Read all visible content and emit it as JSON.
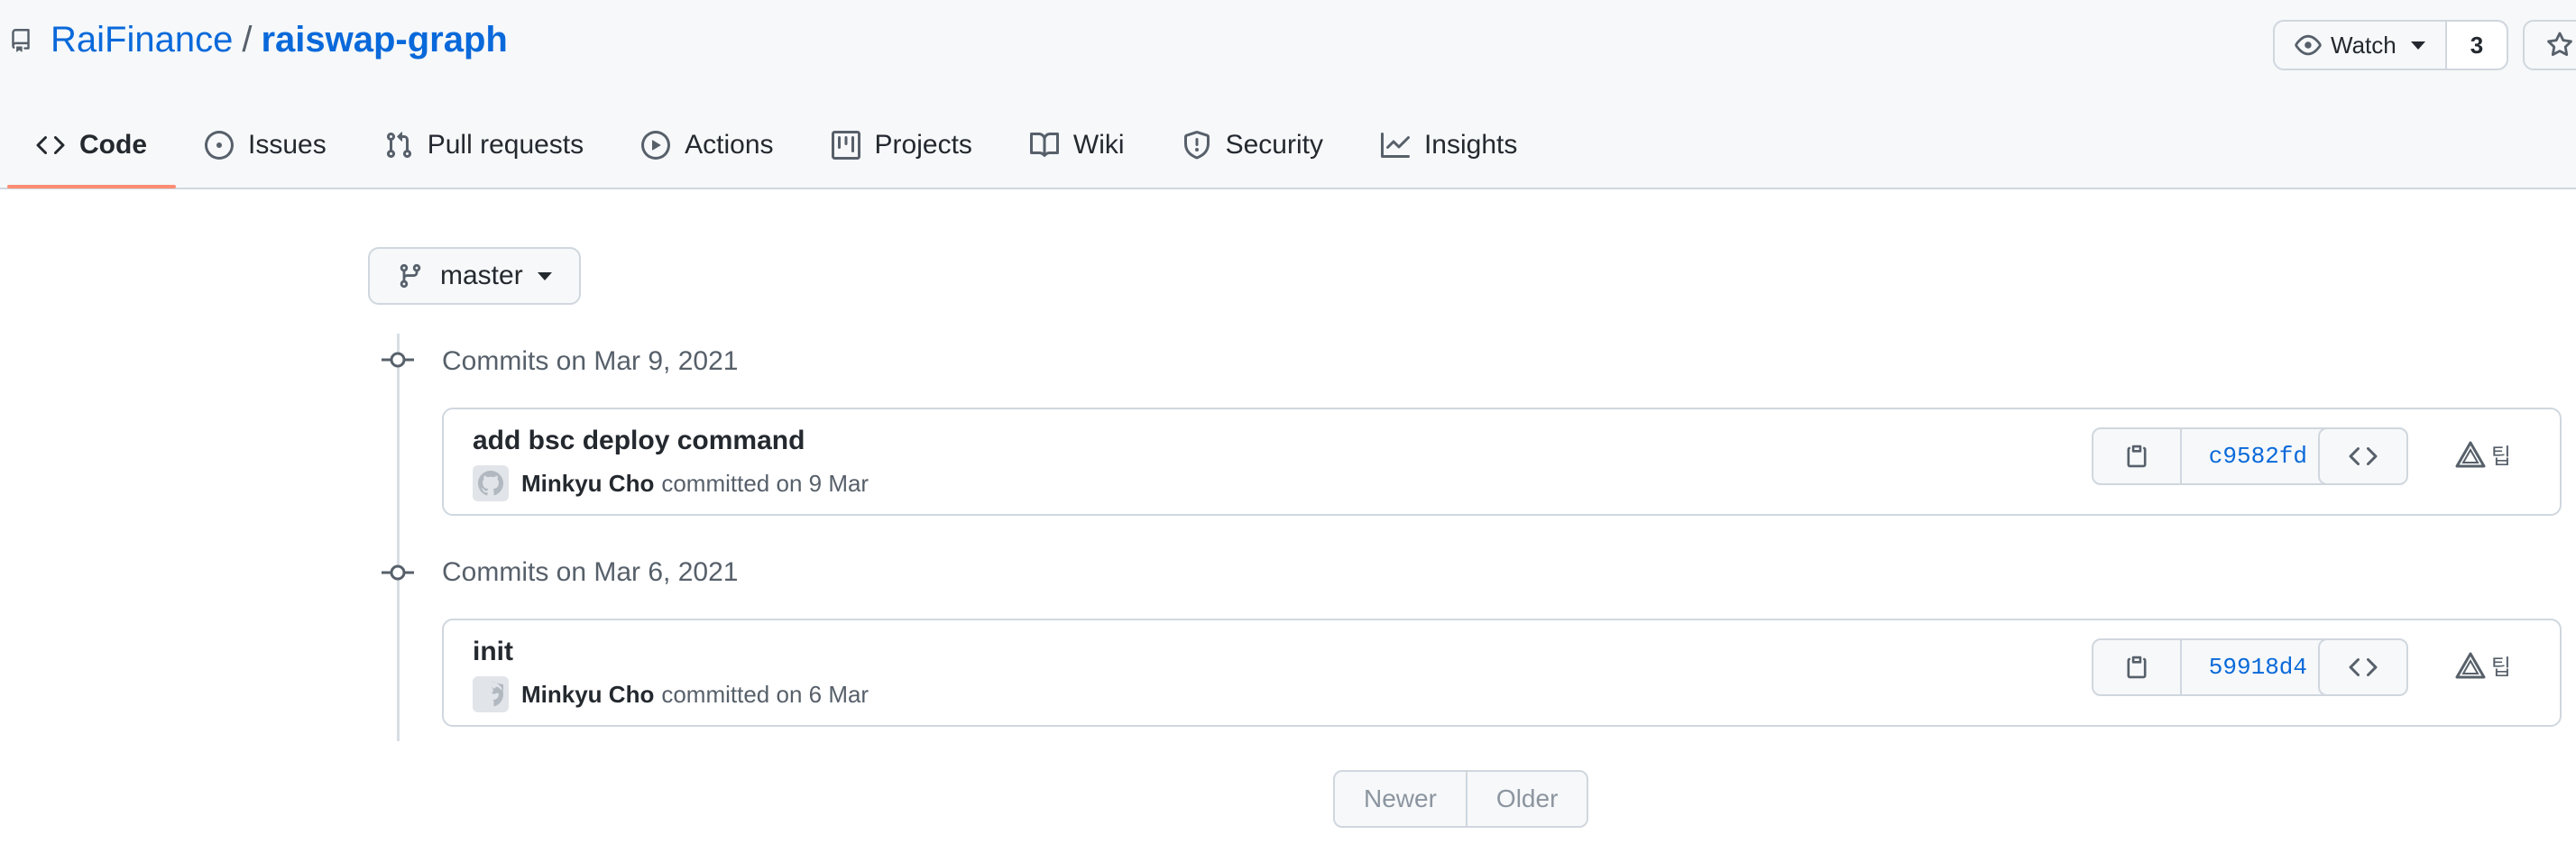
{
  "repo": {
    "owner": "RaiFinance",
    "separator": "/",
    "name": "raiswap-graph"
  },
  "watch": {
    "label": "Watch",
    "count": "3"
  },
  "tabs": [
    {
      "label": "Code",
      "icon": "code-icon",
      "active": true
    },
    {
      "label": "Issues",
      "icon": "issue-icon"
    },
    {
      "label": "Pull requests",
      "icon": "pull-request-icon"
    },
    {
      "label": "Actions",
      "icon": "play-icon"
    },
    {
      "label": "Projects",
      "icon": "project-icon"
    },
    {
      "label": "Wiki",
      "icon": "book-icon"
    },
    {
      "label": "Security",
      "icon": "shield-icon"
    },
    {
      "label": "Insights",
      "icon": "graph-icon"
    }
  ],
  "branch": {
    "label": "master"
  },
  "commit_groups": [
    {
      "title": "Commits on Mar 9, 2021",
      "commits": [
        {
          "message": "add bsc deploy command",
          "author": "Minkyu Cho",
          "meta": "committed on 9 Mar",
          "sha": "c9582fd"
        }
      ]
    },
    {
      "title": "Commits on Mar 6, 2021",
      "commits": [
        {
          "message": "init",
          "author": "Minkyu Cho",
          "meta": "committed on 6 Mar",
          "sha": "59918d4"
        }
      ]
    }
  ],
  "ext_label": "팁",
  "pagination": {
    "newer": "Newer",
    "older": "Older"
  },
  "colors": {
    "link": "#0969da",
    "active_tab_underline": "#fd8c73",
    "border": "#d0d7de",
    "muted": "#57606a"
  }
}
